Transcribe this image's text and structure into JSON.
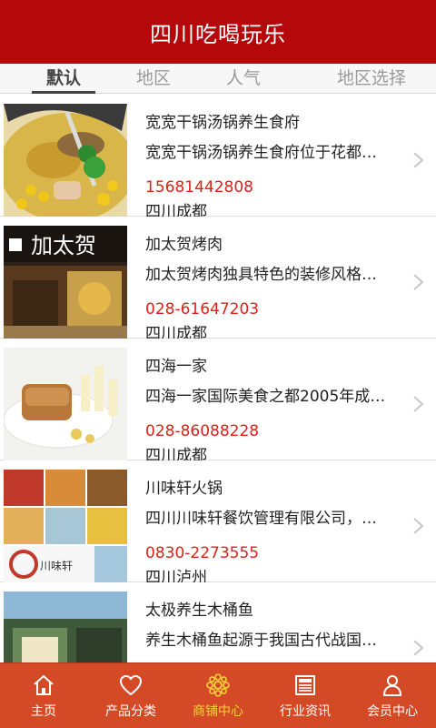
{
  "header": {
    "title": "四川吃喝玩乐"
  },
  "tabs": [
    {
      "label": "默认",
      "active": true
    },
    {
      "label": "地区",
      "active": false
    },
    {
      "label": "人气",
      "active": false
    },
    {
      "label": "地区选择",
      "active": false
    }
  ],
  "items": [
    {
      "name": "宽宽干锅汤锅养生食府",
      "desc": "宽宽干锅汤锅养生食府位于花都…",
      "phone": "15681442808",
      "city": "四川成都"
    },
    {
      "name": "加太贺烤肉",
      "desc": "加太贺烤肉独具特色的装修风格…",
      "phone": "028-61647203",
      "city": "四川成都",
      "sign_text": "加太贺"
    },
    {
      "name": "四海一家",
      "desc": "四海一家国际美食之都2005年成…",
      "phone": "028-86088228",
      "city": "四川成都"
    },
    {
      "name": "川味轩火锅",
      "desc": "四川川味轩餐饮管理有限公司，…",
      "phone": "0830-2273555",
      "city": "四川泸州",
      "sign_text": "川味轩"
    },
    {
      "name": "太极养生木桶鱼",
      "desc": "养生木桶鱼起源于我国古代战国…",
      "phone": "",
      "city": ""
    }
  ],
  "bottom_nav": [
    {
      "label": "主页",
      "icon": "home-icon",
      "active": false
    },
    {
      "label": "产品分类",
      "icon": "heart-icon",
      "active": false
    },
    {
      "label": "商铺中心",
      "icon": "flower-gear-icon",
      "active": true
    },
    {
      "label": "行业资讯",
      "icon": "news-icon",
      "active": false
    },
    {
      "label": "会员中心",
      "icon": "person-icon",
      "active": false
    }
  ],
  "colors": {
    "header": "#b5080b",
    "bottom_nav": "#d54a26",
    "phone": "#e0201a",
    "active_nav": "#f5d23a"
  }
}
